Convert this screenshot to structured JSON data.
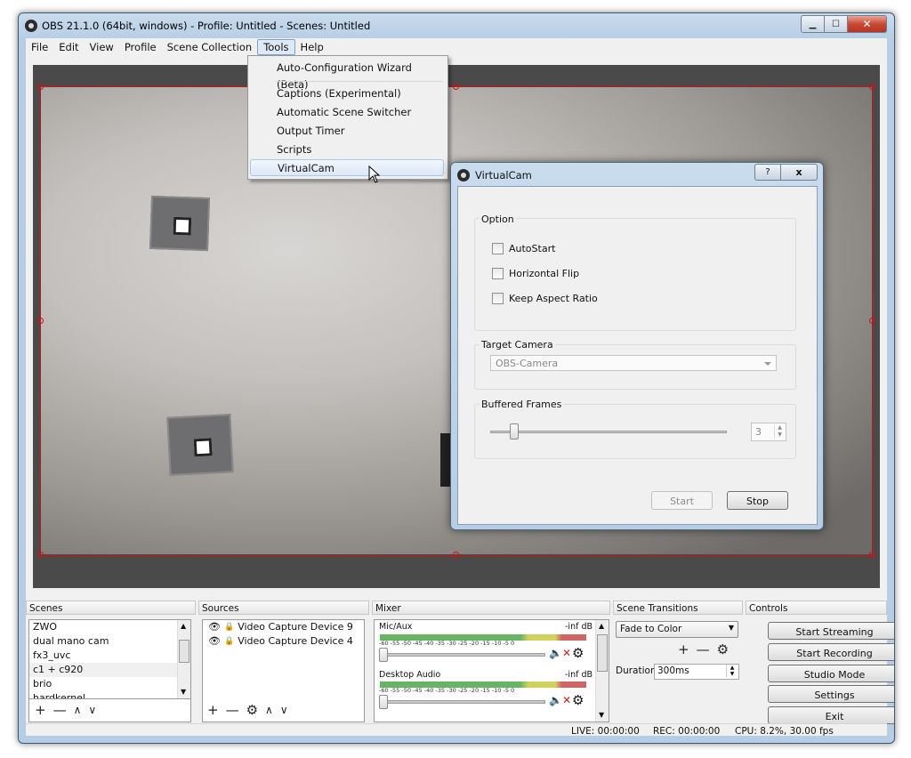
{
  "window": {
    "title": "OBS 21.1.0 (64bit, windows) - Profile: Untitled - Scenes: Untitled"
  },
  "menubar": [
    "File",
    "Edit",
    "View",
    "Profile",
    "Scene Collection",
    "Tools",
    "Help"
  ],
  "tools_menu": {
    "items": [
      "Auto-Configuration Wizard (Beta)",
      "Captions (Experimental)",
      "Automatic Scene Switcher",
      "Output Timer",
      "Scripts",
      "VirtualCam"
    ],
    "highlighted": "VirtualCam"
  },
  "virtualcam_dialog": {
    "title": "VirtualCam",
    "help_glyph": "?",
    "close_glyph": "x",
    "option_group": "Option",
    "checkboxes": [
      "AutoStart",
      "Horizontal Flip",
      "Keep Aspect Ratio"
    ],
    "target_group": "Target Camera",
    "target_value": "OBS-Camera",
    "buffer_group": "Buffered Frames",
    "buffer_value": "3",
    "buffer_slider_fraction": 0.1,
    "start_label": "Start",
    "stop_label": "Stop"
  },
  "docks": {
    "scenes": {
      "title": "Scenes",
      "items": [
        "ZWO",
        "dual mano cam",
        "fx3_uvc",
        "c1 + c920",
        "brio",
        "hardkernel"
      ],
      "selected": "c1 + c920"
    },
    "sources": {
      "title": "Sources",
      "items": [
        "Video Capture Device 9",
        "Video Capture Device 4"
      ]
    },
    "mixer": {
      "title": "Mixer",
      "channels": [
        {
          "name": "Mic/Aux",
          "level": "-inf dB"
        },
        {
          "name": "Desktop Audio",
          "level": "-inf dB"
        }
      ],
      "scale": "-60 -55 -50 -45 -40 -35 -30 -25 -20 -15 -10 -5 0"
    },
    "transitions": {
      "title": "Scene Transitions",
      "selected": "Fade to Color",
      "duration_label": "Duration",
      "duration_value": "300ms"
    },
    "controls": {
      "title": "Controls",
      "buttons": [
        "Start Streaming",
        "Start Recording",
        "Studio Mode",
        "Settings",
        "Exit"
      ]
    }
  },
  "statusbar": {
    "live": "LIVE: 00:00:00",
    "rec": "REC: 00:00:00",
    "cpu": "CPU: 8.2%, 30.00 fps"
  },
  "colors": {
    "selection_red": "#d21010",
    "mute_red": "#cc2020",
    "titlebar": "#b6cde4"
  }
}
